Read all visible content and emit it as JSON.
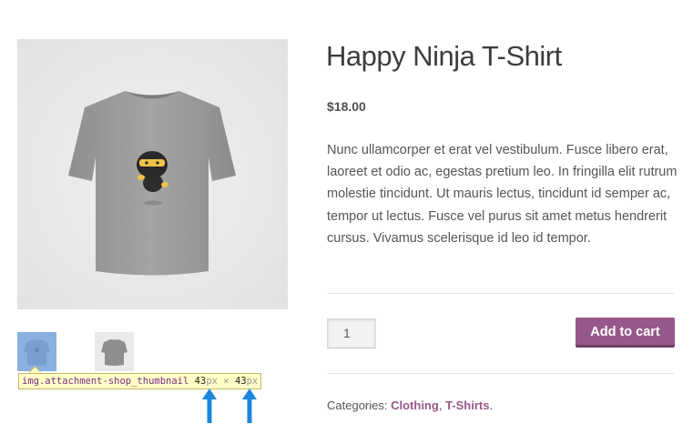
{
  "product": {
    "title": "Happy Ninja T-Shirt",
    "price": "$18.00",
    "description": "Nunc ullamcorper et erat vel vestibulum. Fusce libero erat, laoreet et odio ac, egestas pretium leo. In fringilla elit rutrum molestie tincidunt. Ut mauris lectus, tincidunt id semper ac, tempor ut lectus. Fusce vel purus sit amet metus hendrerit cursus. Vivamus scelerisque id leo id tempor.",
    "quantity": "1",
    "add_to_cart_label": "Add to cart",
    "categories_label": "Categories:",
    "categories": [
      "Clothing",
      "T-Shirts"
    ],
    "category_separator": ", ",
    "category_end": "."
  },
  "devtools_tooltip": {
    "selector": "img.attachment-shop_thumbnail",
    "width": "43",
    "height": "43",
    "unit": "px",
    "times": "×"
  },
  "colors": {
    "accent": "#96588a",
    "arrow": "#1a86e0",
    "tooltip_bg": "#ffffc6",
    "highlight": "#6ea0dc"
  },
  "icons": [
    "up-arrow-icon",
    "up-arrow-icon"
  ]
}
